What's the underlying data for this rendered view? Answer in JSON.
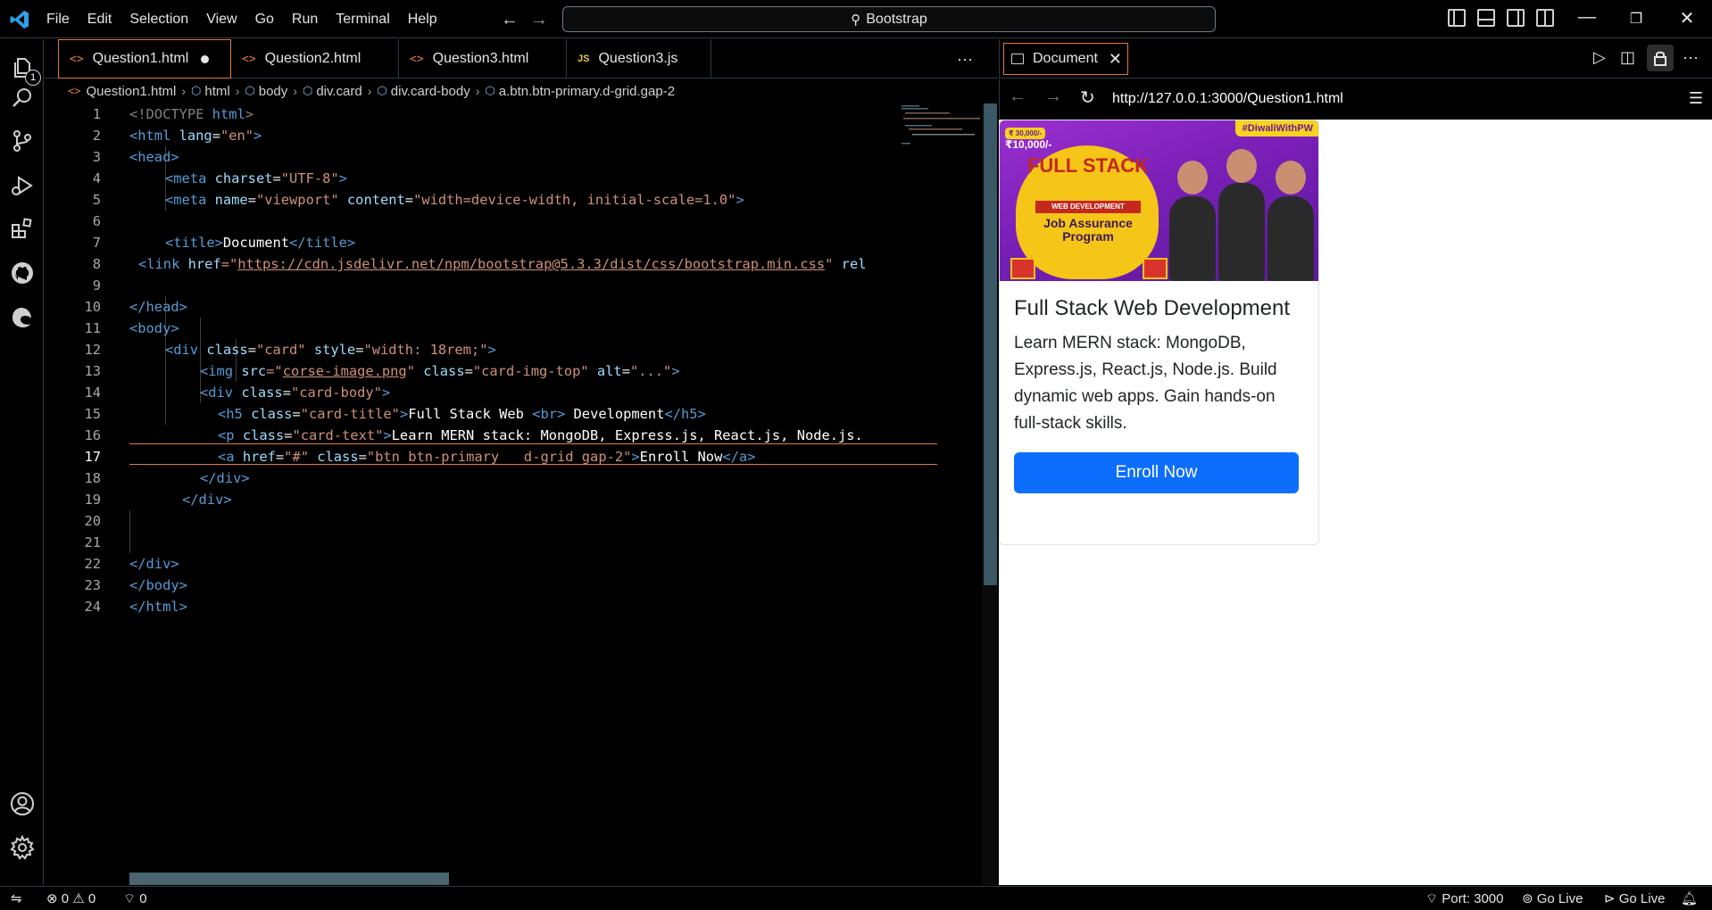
{
  "menu": [
    "File",
    "Edit",
    "Selection",
    "View",
    "Go",
    "Run",
    "Terminal",
    "Help"
  ],
  "search": {
    "text": "Bootstrap"
  },
  "activity_badge": "1",
  "tabs": [
    {
      "label": "Question1.html",
      "icon": "<>"
    },
    {
      "label": "Question2.html",
      "icon": "<>"
    },
    {
      "label": "Question3.html",
      "icon": "<>"
    },
    {
      "label": "Question3.js",
      "icon": "JS"
    }
  ],
  "breadcrumb": [
    "Question1.html",
    "html",
    "body",
    "div.card",
    "div.card-body",
    "a.btn.btn-primary.d-grid.gap-2"
  ],
  "line_numbers": [
    "1",
    "2",
    "3",
    "4",
    "5",
    "6",
    "7",
    "8",
    "9",
    "10",
    "11",
    "12",
    "13",
    "14",
    "15",
    "16",
    "17",
    "18",
    "19",
    "20",
    "21",
    "22",
    "23",
    "24"
  ],
  "code": {
    "l1_a": "<!DOCTYPE",
    "l1_b": " html",
    "l1_c": ">",
    "l2_a": "<html",
    "l2_b": " lang",
    "l2_c": "=",
    "l2_d": "\"en\"",
    "l2_e": ">",
    "l3": "<head>",
    "l4_a": "<meta",
    "l4_b": " charset",
    "l4_c": "=",
    "l4_d": "\"UTF-8\"",
    "l4_e": ">",
    "l5_a": "<meta",
    "l5_b": " name",
    "l5_c": "=",
    "l5_d": "\"viewport\"",
    "l5_e": " content",
    "l5_f": "=",
    "l5_g": "\"width=device-width, initial-scale=1.0\"",
    "l5_h": ">",
    "l7_a": "<title>",
    "l7_b": "Document",
    "l7_c": "</title>",
    "l8_a": "<link",
    "l8_b": " href",
    "l8_c": "=\"",
    "l8_d": "https://cdn.jsdelivr.net/npm/bootstrap@5.3.3/dist/css/bootstrap.min.css",
    "l8_e": "\"",
    "l8_f": " rel",
    "l10": "</head>",
    "l11": "<body>",
    "l12_a": "<div",
    "l12_b": " class",
    "l12_c": "=",
    "l12_d": "\"card\"",
    "l12_e": " style",
    "l12_f": "=",
    "l12_g": "\"width: 18rem;\"",
    "l12_h": ">",
    "l13_a": "<img",
    "l13_b": " src",
    "l13_c": "=\"",
    "l13_d": "corse-image.png",
    "l13_e": "\"",
    "l13_f": " class",
    "l13_g": "=",
    "l13_h": "\"card-img-top\"",
    "l13_i": " alt",
    "l13_j": "=",
    "l13_k": "\"...\"",
    "l13_l": ">",
    "l14_a": "<div",
    "l14_b": " class",
    "l14_c": "=",
    "l14_d": "\"card-body\"",
    "l14_e": ">",
    "l15_a": "<h5",
    "l15_b": " class",
    "l15_c": "=",
    "l15_d": "\"card-title\"",
    "l15_e": ">",
    "l15_f": "Full Stack Web ",
    "l15_g": "<br>",
    "l15_h": " Development",
    "l15_i": "</h5>",
    "l16_a": "<p",
    "l16_b": " class",
    "l16_c": "=",
    "l16_d": "\"card-text\"",
    "l16_e": ">",
    "l16_f": "Learn MERN stack: MongoDB, Express.js, React.js, Node.js.",
    "l17_a": "<a",
    "l17_b": " href",
    "l17_c": "=",
    "l17_d": "\"#\"",
    "l17_e": " class",
    "l17_f": "=",
    "l17_g": "\"btn btn-primary   d-grid gap-2\"",
    "l17_h": ">",
    "l17_i": "Enroll Now",
    "l17_j": "</a>",
    "l18": "</div>",
    "l19": "</div>",
    "l22": "</div>",
    "l23": "</body>",
    "l24": "</html>"
  },
  "browser": {
    "tab_label": "Document",
    "url": "http://127.0.0.1:3000/Question1.html"
  },
  "card": {
    "hashtag": "#DiwaliWithPW",
    "price_old": "₹ 30,000/-",
    "price_new": "₹10,000/-",
    "banner_title": "FULL STACK",
    "banner_tag": "WEB DEVELOPMENT",
    "banner_sub": "Job Assurance Program",
    "title": "Full Stack Web Development",
    "text": "Learn MERN stack: MongoDB, Express.js, React.js, Node.js. Build dynamic web apps. Gain hands-on full-stack skills.",
    "button": "Enroll Now"
  },
  "status": {
    "errors": "0",
    "warnings": "0",
    "ports": "0",
    "port": "Port: 3000",
    "golive1": "Go Live",
    "golive2": "Go Live"
  }
}
